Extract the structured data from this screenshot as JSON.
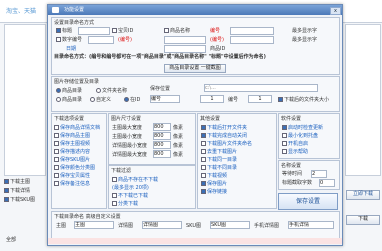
{
  "background": {
    "search_placeholder": "淘宝、天猫",
    "left_checks": [
      "下载主图",
      "下载详情",
      "下载SKU图"
    ],
    "right_buttons": [
      "立即下载",
      "下载"
    ],
    "bottom_left": "全部"
  },
  "dialog": {
    "title": "功能设置",
    "close": "x",
    "naming": {
      "group": "设置目录命名方式",
      "opt1": "标题",
      "opt2": "宝贝ID",
      "opt3": "商品名称",
      "opt4": "编号",
      "preview_label": "最多显示字",
      "row2_left": "数字编号",
      "row2_mid": "(编号)",
      "row2_right": "(编号)",
      "row2_field": "最多显示字",
      "row3_left": "日期",
      "row3_right": "商品ID",
      "hint": "目录命名方式：(编号和编号都可在一项\"商品目录\"或\"商品目录名称\"  \"标题\"中设置后作为命名)",
      "btn": "商品目录设置 一键截图"
    },
    "img_group": {
      "title": "图片存储位置及目录",
      "o1": "商品目录",
      "o2": "文件夹名称",
      "o3": "商品目录",
      "o4": "自定义",
      "o5": "在ID",
      "save_path_label": "保存位置",
      "path_value": "c:\\...",
      "num_label": "编号",
      "num_value": "1",
      "num_label2": "编号",
      "num_value2": "1",
      "after_label": "下载后的文件夹大小",
      "pos_option": "编号在前"
    },
    "download": {
      "title": "下载选项设置",
      "items": [
        "保存商品详情文档",
        "保存商品主图",
        "保存主图视频",
        "保存描述内容",
        "保存SKU图片",
        "保存颜色分类图",
        "保存宝贝属性",
        "保存备注信息"
      ]
    },
    "size": {
      "title": "图片尺寸设置",
      "rows": [
        {
          "label": "主图最大宽度",
          "value": "800",
          "unit": "像素"
        },
        {
          "label": "主图最小宽度",
          "value": "800",
          "unit": "像素"
        },
        {
          "label": "详情图最小宽度",
          "value": "800",
          "unit": "像素"
        },
        {
          "label": "详情图最大宽度",
          "value": "800",
          "unit": "像素"
        }
      ]
    },
    "other": {
      "title": "其他设置",
      "items": [
        "下载后打开文件夹",
        "下载完成自动关闭",
        "下载图片文件夹命名",
        "去重下载图片",
        "下载同一目录",
        "下载不同目录",
        "下载视频",
        "保存图片",
        "保存链接"
      ]
    },
    "soft": {
      "title": "软件设置",
      "items": [
        "启动时检查更新",
        "最小化到托盘",
        "开机自启",
        "显示帮助"
      ],
      "wait_label": "等待时间",
      "wait_value": "2"
    },
    "filter": {
      "title": "下载过滤",
      "items": [
        "商品不存在不下载",
        "(最多显示 20项)",
        "不下载已下载",
        "分类下载"
      ]
    },
    "name_rules": {
      "title": "名称设置",
      "rows": [
        {
          "label": "标题截取字数",
          "value": "0"
        },
        {
          "label": "宝贝ID前缀",
          "value": "0"
        },
        {
          "label": "编号前缀",
          "value": "0"
        }
      ]
    },
    "save_btn": "保存设置",
    "bottom_bar": {
      "title": "下载目录命名  高级自定义设置",
      "items": [
        {
          "label": "主图",
          "field": "主图"
        },
        {
          "label": "详情图",
          "field": "详情图"
        },
        {
          "label": "SKU图",
          "field": "SKU图"
        },
        {
          "label": "手机详情图",
          "field": "手机详情"
        }
      ]
    }
  }
}
